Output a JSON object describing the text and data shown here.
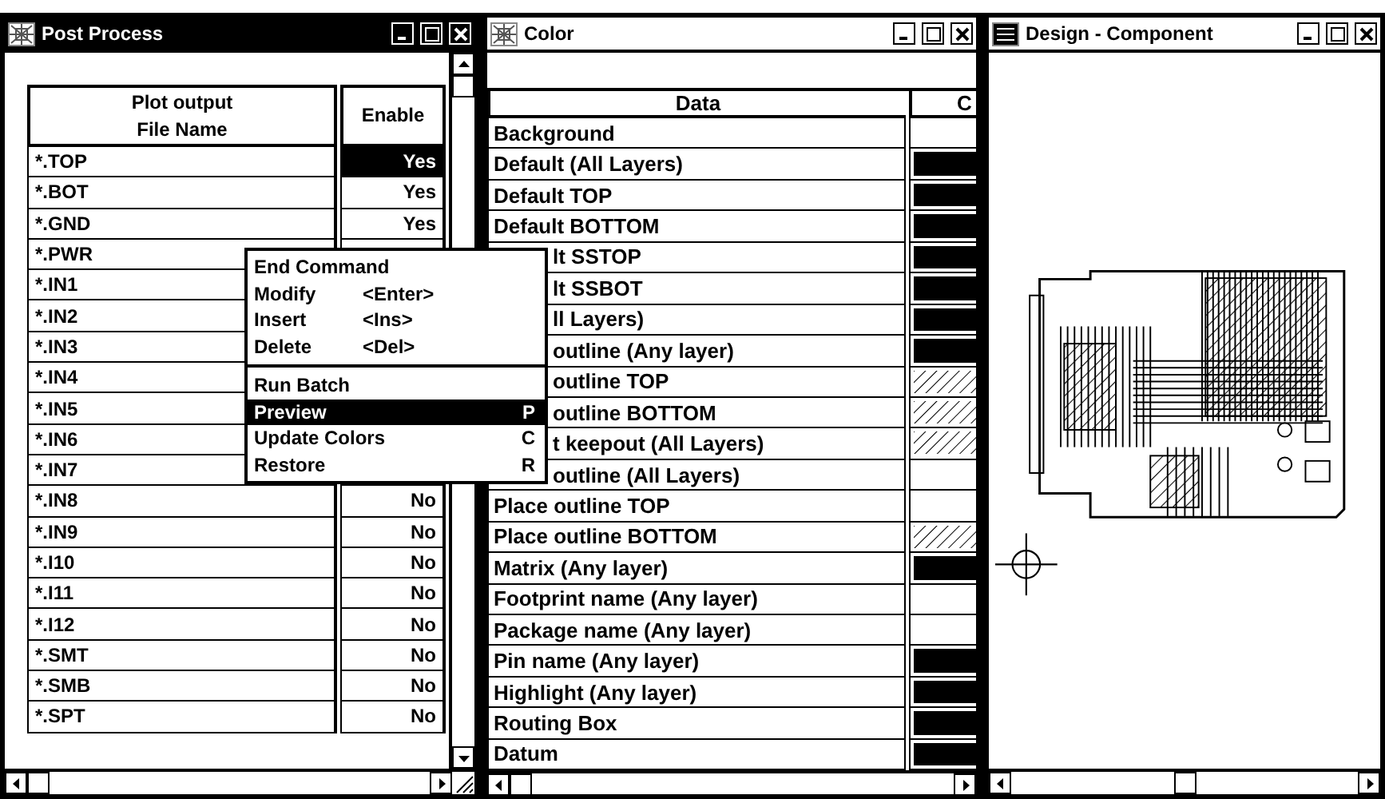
{
  "post_process": {
    "title": "Post Process",
    "active": true,
    "columns": [
      {
        "lines": [
          "Plot output",
          "File Name"
        ]
      },
      {
        "lines": [
          "Enable"
        ]
      }
    ],
    "rows": [
      {
        "file": "*.TOP",
        "enable": "Yes",
        "selected": true
      },
      {
        "file": "*.BOT",
        "enable": "Yes",
        "selected": false
      },
      {
        "file": "*.GND",
        "enable": "Yes",
        "selected": false
      },
      {
        "file": "*.PWR"
      },
      {
        "file": "*.IN1"
      },
      {
        "file": "*.IN2"
      },
      {
        "file": "*.IN3"
      },
      {
        "file": "*.IN4"
      },
      {
        "file": "*.IN5"
      },
      {
        "file": "*.IN6"
      },
      {
        "file": "*.IN7"
      },
      {
        "file": "*.IN8",
        "enable": "No",
        "selected": false
      },
      {
        "file": "*.IN9",
        "enable": "No",
        "selected": false
      },
      {
        "file": "*.I10",
        "enable": "No",
        "selected": false
      },
      {
        "file": "*.I11",
        "enable": "No",
        "selected": false
      },
      {
        "file": "*.I12",
        "enable": "No",
        "selected": false
      },
      {
        "file": "*.SMT",
        "enable": "No",
        "selected": false
      },
      {
        "file": "*.SMB",
        "enable": "No",
        "selected": false
      },
      {
        "file": "*.SPT",
        "enable": "No",
        "selected": false
      }
    ]
  },
  "color": {
    "title": "Color",
    "active": false,
    "columns": [
      "Data",
      "C"
    ],
    "rows": [
      {
        "data": "Background",
        "kind": "none",
        "partly_hidden": false
      },
      {
        "data": "Default (All Layers)",
        "kind": "solid",
        "partly_hidden": false
      },
      {
        "data": "Default TOP",
        "kind": "solid",
        "partly_hidden": false
      },
      {
        "data": "Default BOTTOM",
        "kind": "solid",
        "partly_hidden": false
      },
      {
        "data": "lt SSTOP",
        "kind": "solid",
        "partly_hidden": true
      },
      {
        "data": "lt SSBOT",
        "kind": "solid",
        "partly_hidden": true
      },
      {
        "data": "ll Layers)",
        "kind": "solid",
        "partly_hidden": true
      },
      {
        "data": "outline (Any layer)",
        "kind": "solid",
        "partly_hidden": true
      },
      {
        "data": "outline TOP",
        "kind": "hatch",
        "partly_hidden": true
      },
      {
        "data": "outline BOTTOM",
        "kind": "hatch",
        "partly_hidden": true
      },
      {
        "data": "t keepout (All Layers)",
        "kind": "hatch",
        "partly_hidden": true
      },
      {
        "data": "outline (All Layers)",
        "kind": "none",
        "partly_hidden": true
      },
      {
        "data": "Place outline TOP",
        "kind": "none",
        "partly_hidden": false
      },
      {
        "data": "Place outline BOTTOM",
        "kind": "hatch",
        "partly_hidden": false
      },
      {
        "data": "Matrix (Any layer)",
        "kind": "solid",
        "partly_hidden": false
      },
      {
        "data": "Footprint name (Any layer)",
        "kind": "none",
        "partly_hidden": false
      },
      {
        "data": "Package name (Any layer)",
        "kind": "none",
        "partly_hidden": false
      },
      {
        "data": "Pin name (Any layer)",
        "kind": "solid",
        "partly_hidden": false
      },
      {
        "data": "Highlight (Any layer)",
        "kind": "solid",
        "partly_hidden": false
      },
      {
        "data": "Routing Box",
        "kind": "solid",
        "partly_hidden": false
      },
      {
        "data": "Datum",
        "kind": "solid",
        "partly_hidden": false
      }
    ]
  },
  "design": {
    "title": "Design - Component",
    "active": false
  },
  "context_menu": {
    "items": [
      {
        "label": "End Command",
        "separator_before": false,
        "selected": false
      },
      {
        "label": "Modify",
        "shortcut": "<Enter>",
        "separator_before": false,
        "selected": false
      },
      {
        "label": "Insert",
        "shortcut": "<Ins>",
        "separator_before": false,
        "selected": false
      },
      {
        "label": "Delete",
        "shortcut": "<Del>",
        "separator_before": false,
        "selected": false
      },
      {
        "label": "Run Batch",
        "separator_before": true,
        "selected": false
      },
      {
        "label": "Preview",
        "shortcut": "P",
        "separator_before": false,
        "selected": true
      },
      {
        "label": "Update Colors",
        "shortcut": "C",
        "separator_before": false,
        "selected": false
      },
      {
        "label": "Restore",
        "shortcut": "R",
        "separator_before": false,
        "selected": false
      }
    ]
  }
}
